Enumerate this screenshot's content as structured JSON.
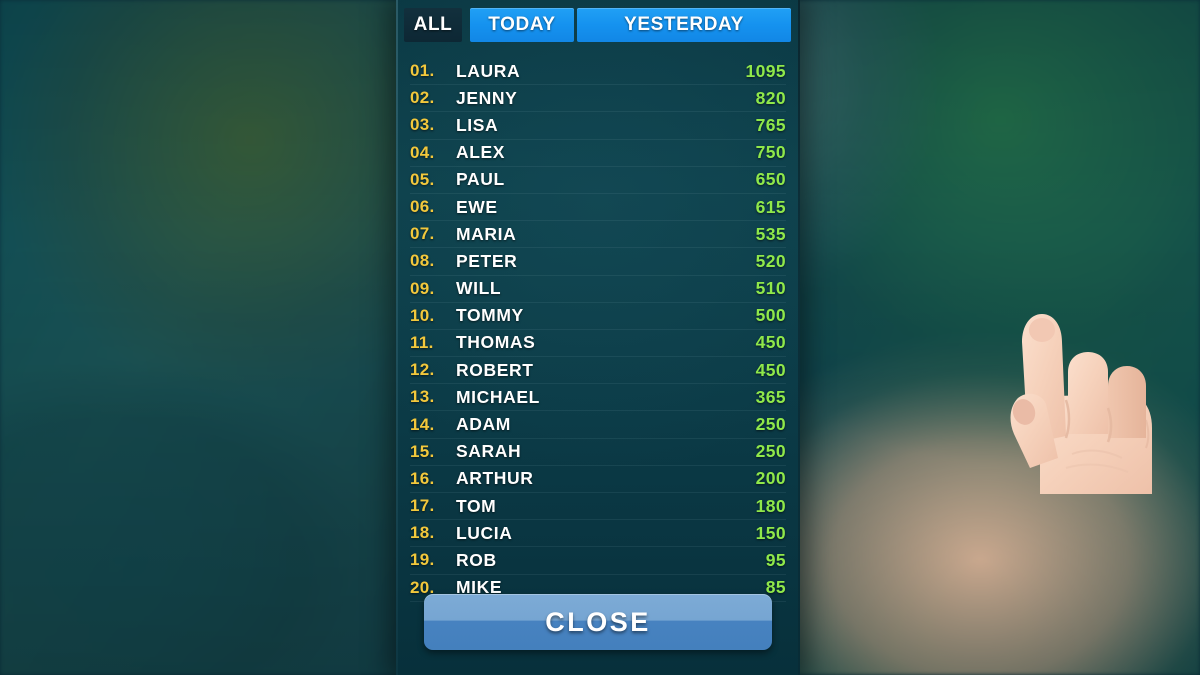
{
  "background": {
    "description": "blurred teal-green gradient backdrop",
    "colors": [
      "#0d4a52",
      "#1b5456",
      "#16564f",
      "#f3c7a8"
    ]
  },
  "panel": {
    "accent_blue": "#1592ef",
    "rank_color": "#f2c83c",
    "name_color": "#ffffff",
    "score_color": "#8fe84a"
  },
  "tabs": [
    {
      "label": "ALL",
      "active": false
    },
    {
      "label": "TODAY",
      "active": true
    },
    {
      "label": "YESTERDAY",
      "active": true
    }
  ],
  "leaderboard": {
    "rows": [
      {
        "rank": "01.",
        "name": "LAURA",
        "score": "1095"
      },
      {
        "rank": "02.",
        "name": "JENNY",
        "score": "820"
      },
      {
        "rank": "03.",
        "name": "LISA",
        "score": "765"
      },
      {
        "rank": "04.",
        "name": "ALEX",
        "score": "750"
      },
      {
        "rank": "05.",
        "name": "PAUL",
        "score": "650"
      },
      {
        "rank": "06.",
        "name": "EWE",
        "score": "615"
      },
      {
        "rank": "07.",
        "name": "MARIA",
        "score": "535"
      },
      {
        "rank": "08.",
        "name": "PETER",
        "score": "520"
      },
      {
        "rank": "09.",
        "name": "WILL",
        "score": "510"
      },
      {
        "rank": "10.",
        "name": "TOMMY",
        "score": "500"
      },
      {
        "rank": "11.",
        "name": "THOMAS",
        "score": "450"
      },
      {
        "rank": "12.",
        "name": "ROBERT",
        "score": "450"
      },
      {
        "rank": "13.",
        "name": "MICHAEL",
        "score": "365"
      },
      {
        "rank": "14.",
        "name": "ADAM",
        "score": "250"
      },
      {
        "rank": "15.",
        "name": "SARAH",
        "score": "250"
      },
      {
        "rank": "16.",
        "name": "ARTHUR",
        "score": "200"
      },
      {
        "rank": "17.",
        "name": "TOM",
        "score": "180"
      },
      {
        "rank": "18.",
        "name": "LUCIA",
        "score": "150"
      },
      {
        "rank": "19.",
        "name": "ROB",
        "score": "95"
      },
      {
        "rank": "20.",
        "name": "MIKE",
        "score": "85"
      }
    ]
  },
  "cursor": {
    "icon": "pointing-hand-cursor"
  },
  "footer": {
    "close_label": "CLOSE"
  }
}
